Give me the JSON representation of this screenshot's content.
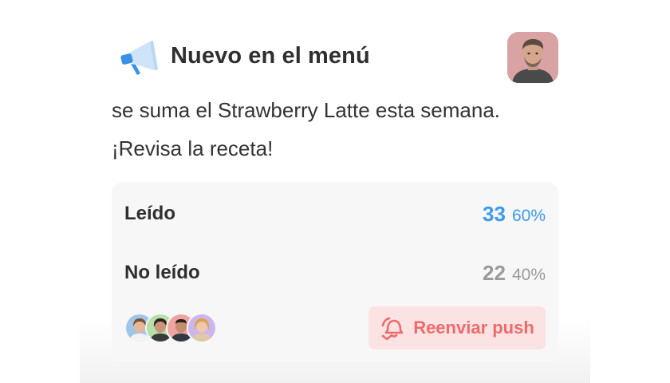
{
  "announcement": {
    "title": "Nuevo en el menú",
    "icon": "megaphone-icon",
    "message": "se suma el Strawberry Latte esta semana. ¡Revisa la receta!"
  },
  "stats": {
    "read": {
      "label": "Leído",
      "count": "33",
      "percent": "60%"
    },
    "unread": {
      "label": "No leído",
      "count": "22",
      "percent": "40%"
    }
  },
  "readers": [
    "reader-avatar-1",
    "reader-avatar-2",
    "reader-avatar-3",
    "reader-avatar-4"
  ],
  "actions": {
    "resend_label": "Reenviar push",
    "resend_icon": "bell-resend-icon"
  },
  "colors": {
    "accent_blue": "#3a9bf0",
    "muted_gray": "#9a9a9a",
    "resend_red": "#ee6b6b",
    "resend_bg": "#fbe3e3"
  }
}
